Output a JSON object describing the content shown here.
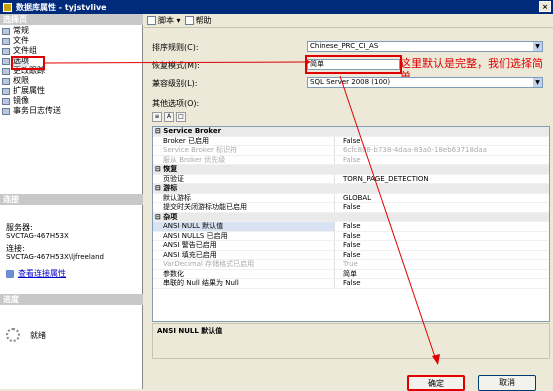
{
  "window": {
    "title": "数据库属性 - tyjstvlive",
    "close_label": "×"
  },
  "left": {
    "select_page_header": "选择页",
    "nav_items": [
      {
        "label": "常规"
      },
      {
        "label": "文件"
      },
      {
        "label": "文件组"
      },
      {
        "label": "选项"
      },
      {
        "label": "更改跟踪"
      },
      {
        "label": "权限"
      },
      {
        "label": "扩展属性"
      },
      {
        "label": "镜像"
      },
      {
        "label": "事务日志传送"
      }
    ],
    "connection_header": "连接",
    "server_label": "服务器:",
    "server_value": "SVCTAG-467H53X",
    "connection_label": "连接:",
    "connection_value": "SVCTAG-467H53X\\ljfreeland",
    "view_link": "查看连接属性",
    "progress_header": "进度",
    "progress_status": "就绪"
  },
  "toolbar": {
    "script_label": "脚本 ▾",
    "help_label": "帮助"
  },
  "fields": {
    "collation_label": "排序规则(C):",
    "collation_value": "Chinese_PRC_CI_AS",
    "recovery_label": "恢复模式(M):",
    "recovery_value": "简单",
    "compat_label": "兼容级别(L):",
    "compat_value": "SQL Server 2008 (100)",
    "other_label": "其他选项(O):"
  },
  "annotation": "这里默认是完整，我们选择简单",
  "grid": {
    "rows": [
      {
        "type": "cat",
        "name": "⊟ Service Broker"
      },
      {
        "name": "Broker 已启用",
        "value": "False"
      },
      {
        "name": "Service Broker 标识符",
        "value": "6cfc808-b738-4daa-83a0-18eb63718daa",
        "dim": true
      },
      {
        "name": "服从 Broker 优先级",
        "value": "False",
        "dim": true
      },
      {
        "type": "cat",
        "name": "⊟ 恢复"
      },
      {
        "name": "页验证",
        "value": "TORN_PAGE_DETECTION"
      },
      {
        "type": "cat",
        "name": "⊟ 游标"
      },
      {
        "name": "默认游标",
        "value": "GLOBAL"
      },
      {
        "name": "提交时关闭游标功能已启用",
        "value": "False"
      },
      {
        "type": "cat",
        "name": "⊟ 杂项"
      },
      {
        "name": "ANSI NULL 默认值",
        "value": "False",
        "sel": true
      },
      {
        "name": "ANSI NULLS 已启用",
        "value": "False"
      },
      {
        "name": "ANSI 警告已启用",
        "value": "False"
      },
      {
        "name": "ANSI 填充已启用",
        "value": "False"
      },
      {
        "name": "VarDecimal 存储格式已启用",
        "value": "True",
        "dim": true
      },
      {
        "name": "参数化",
        "value": "简单"
      },
      {
        "name": "串联的 Null 结果为 Null",
        "value": "False"
      }
    ]
  },
  "description_title": "ANSI NULL 默认值",
  "buttons": {
    "ok": "确定",
    "cancel": "取消"
  },
  "colors": {
    "annotation_red": "#e00000",
    "title_bar": "#002a7a"
  }
}
